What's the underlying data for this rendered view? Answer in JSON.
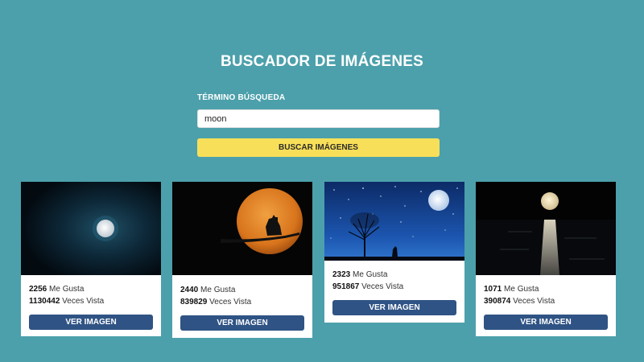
{
  "header": {
    "title": "BUSCADOR DE IMÁGENES"
  },
  "search": {
    "label": "TÉRMINO BÚSQUEDA",
    "value": "moon",
    "button_label": "BUSCAR IMÁGENES"
  },
  "results": [
    {
      "likes": "2256",
      "likes_label": "Me Gusta",
      "views": "1130442",
      "views_label": "Veces Vista",
      "button_label": "VER IMAGEN"
    },
    {
      "likes": "2440",
      "likes_label": "Me Gusta",
      "views": "839829",
      "views_label": "Veces Vista",
      "button_label": "VER IMAGEN"
    },
    {
      "likes": "2323",
      "likes_label": "Me Gusta",
      "views": "951867",
      "views_label": "Veces Vista",
      "button_label": "VER IMAGEN"
    },
    {
      "likes": "1071",
      "likes_label": "Me Gusta",
      "views": "390874",
      "views_label": "Veces Vista",
      "button_label": "VER IMAGEN"
    }
  ],
  "colors": {
    "background": "#4ca0ab",
    "search_button": "#f8df59",
    "view_button": "#2f5384"
  }
}
